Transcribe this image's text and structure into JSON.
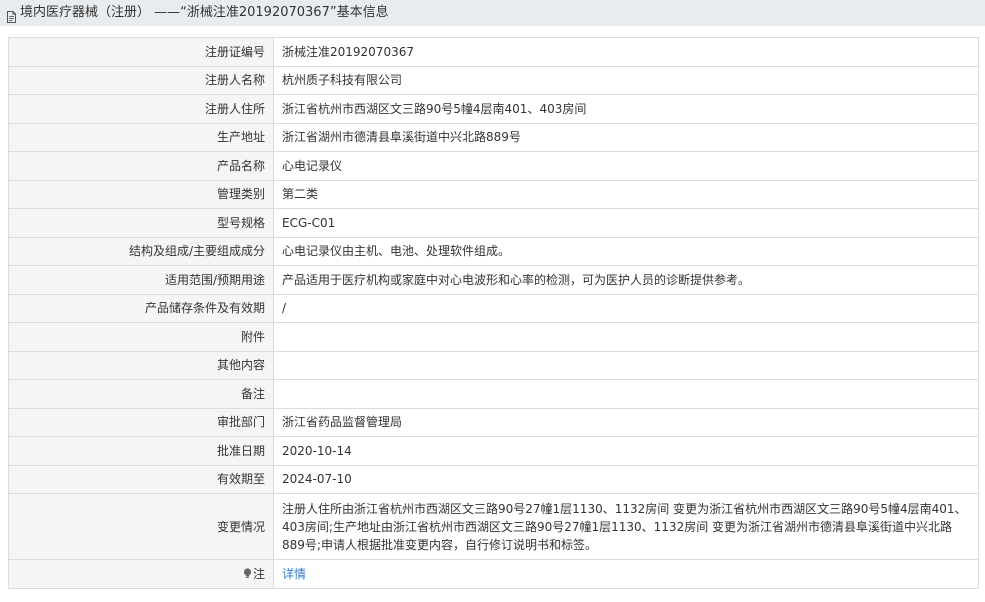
{
  "page_title": "境内医疗器械（注册） ——“浙械注准20192070367”基本信息",
  "rows": [
    {
      "label": "注册证编号",
      "value": "浙械注准20192070367"
    },
    {
      "label": "注册人名称",
      "value": "杭州质子科技有限公司"
    },
    {
      "label": "注册人住所",
      "value": "浙江省杭州市西湖区文三路90号5幢4层南401、403房间"
    },
    {
      "label": "生产地址",
      "value": "浙江省湖州市德清县阜溪街道中兴北路889号"
    },
    {
      "label": "产品名称",
      "value": "心电记录仪"
    },
    {
      "label": "管理类别",
      "value": "第二类"
    },
    {
      "label": "型号规格",
      "value": "ECG-C01"
    },
    {
      "label": "结构及组成/主要组成成分",
      "value": "心电记录仪由主机、电池、处理软件组成。"
    },
    {
      "label": "适用范围/预期用途",
      "value": "产品适用于医疗机构或家庭中对心电波形和心率的检测，可为医护人员的诊断提供参考。"
    },
    {
      "label": "产品储存条件及有效期",
      "value": "/"
    },
    {
      "label": "附件",
      "value": ""
    },
    {
      "label": "其他内容",
      "value": ""
    },
    {
      "label": "备注",
      "value": ""
    },
    {
      "label": "审批部门",
      "value": "浙江省药品监督管理局"
    },
    {
      "label": "批准日期",
      "value": "2020-10-14"
    },
    {
      "label": "有效期至",
      "value": "2024-07-10"
    }
  ],
  "change_row": {
    "label": "变更情况",
    "value": "注册人住所由浙江省杭州市西湖区文三路90号27幢1层1130、1132房间 变更为浙江省杭州市西湖区文三路90号5幢4层南401、403房间;生产地址由浙江省杭州市西湖区文三路90号27幢1层1130、1132房间 变更为浙江省湖州市德清县阜溪街道中兴北路889号;申请人根据批准变更内容，自行修订说明书和标签。"
  },
  "note_row": {
    "label": "注",
    "icon": "lightbulb-icon",
    "link": "详情"
  },
  "colors": {
    "title_bg": "#e9ecef",
    "label_bg": "#f5f5f5",
    "border": "#dcdcdc",
    "link": "#2b7bd0"
  }
}
